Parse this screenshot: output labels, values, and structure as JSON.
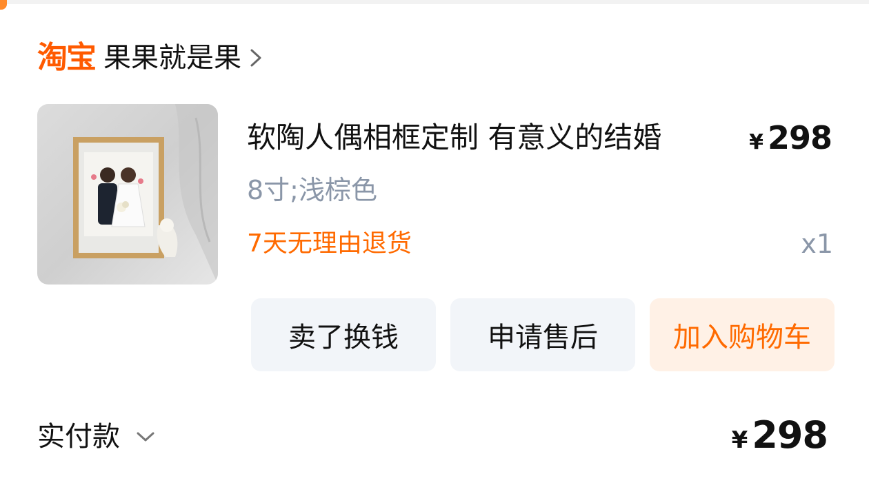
{
  "shop": {
    "logo_text": "淘宝",
    "name": "果果就是果"
  },
  "product": {
    "title": "软陶人偶相框定制 有意义的结婚",
    "price_currency": "¥",
    "price_value": "298",
    "sku": "8寸;浅棕色",
    "return_policy": "7天无理由退货",
    "quantity": "x1",
    "colors": {
      "accent": "#ff6a00",
      "muted": "#8a96a8"
    }
  },
  "actions": {
    "sell": "卖了换钱",
    "after_sales": "申请售后",
    "add_to_cart": "加入购物车"
  },
  "payment": {
    "label": "实付款",
    "currency": "¥",
    "total": "298"
  }
}
